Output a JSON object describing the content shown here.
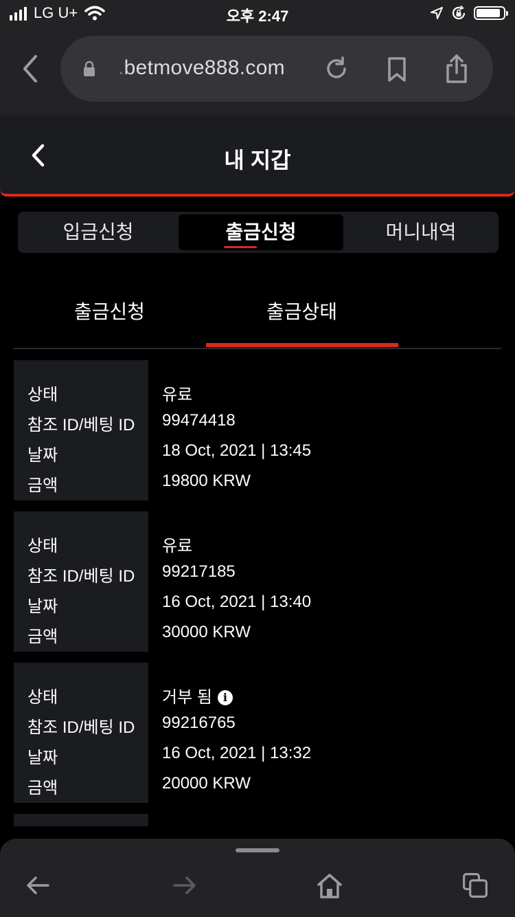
{
  "status_bar": {
    "carrier": "LG U+",
    "time": "오후 2:47"
  },
  "browser": {
    "url_prefix": ".",
    "url": "betmove888.com"
  },
  "header": {
    "title": "내 지갑"
  },
  "tabs": [
    {
      "label": "입금신청"
    },
    {
      "label": "출금신청"
    },
    {
      "label": "머니내역"
    }
  ],
  "active_tab": "출금신청",
  "subtabs": [
    {
      "label": "출금신청"
    },
    {
      "label": "출금상태"
    }
  ],
  "active_subtab": "출금상태",
  "field_labels": {
    "status": "상태",
    "ref": "참조 ID/베팅 ID",
    "date": "날짜",
    "amount": "금액"
  },
  "records": [
    {
      "status": "유료",
      "ref": "99474418",
      "date": "18 Oct, 2021 | 13:45",
      "amount": "19800 KRW"
    },
    {
      "status": "유료",
      "ref": "99217185",
      "date": "16 Oct, 2021 | 13:40",
      "amount": "30000 KRW"
    },
    {
      "status": "거부 됨",
      "ref": "99216765",
      "date": "16 Oct, 2021 | 13:32",
      "amount": "20000 KRW"
    }
  ],
  "info_icon_glyph": "i",
  "colors": {
    "accent": "#d9291c",
    "panel": "#1b1c20",
    "chrome": "#232326"
  }
}
